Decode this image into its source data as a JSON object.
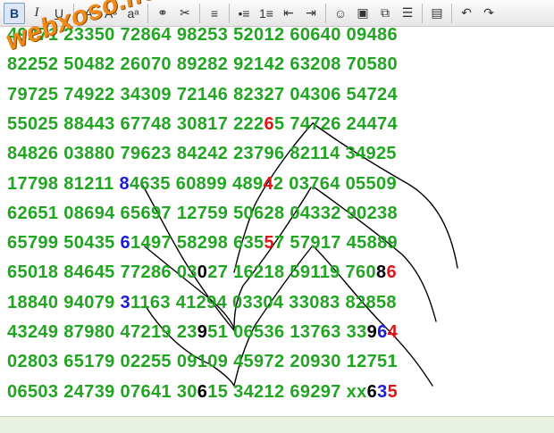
{
  "toolbar": {
    "buttons": [
      {
        "icon": "bold-icon",
        "glyph": "B"
      },
      {
        "icon": "italic-icon",
        "glyph": "I"
      },
      {
        "icon": "underline-icon",
        "glyph": "U"
      },
      {
        "icon": "font-color-icon",
        "glyph": "A"
      },
      {
        "icon": "font-size-icon",
        "glyph": "Aˢ"
      },
      {
        "icon": "superscript-icon",
        "glyph": "aᵃ"
      },
      {
        "icon": "link-icon",
        "glyph": "⚭"
      },
      {
        "icon": "unlink-icon",
        "glyph": "✂"
      },
      {
        "icon": "align-left-icon",
        "glyph": "≡"
      },
      {
        "icon": "bullet-list-icon",
        "glyph": "•≡"
      },
      {
        "icon": "numbered-list-icon",
        "glyph": "1≡"
      },
      {
        "icon": "outdent-icon",
        "glyph": "⇤"
      },
      {
        "icon": "indent-icon",
        "glyph": "⇥"
      },
      {
        "icon": "emoticon-icon",
        "glyph": "☺"
      },
      {
        "icon": "image-icon",
        "glyph": "▣"
      },
      {
        "icon": "paste-icon",
        "glyph": "⧉"
      },
      {
        "icon": "insert-table-icon",
        "glyph": "☰"
      },
      {
        "icon": "save-icon",
        "glyph": "▤"
      },
      {
        "icon": "undo-icon",
        "glyph": "↶"
      },
      {
        "icon": "redo-icon",
        "glyph": "↷"
      }
    ]
  },
  "watermark": "webxoso.net",
  "lines": [
    [
      {
        "t": "49271 23350 72864 98253 52012 60640 09486"
      }
    ],
    [
      {
        "t": "82252 50482 26070 89282 92142 63208 70580"
      }
    ],
    [
      {
        "t": "79725 74922 34309 72146 82327 04306 54724"
      }
    ],
    [
      {
        "t": "55025 88443 67748 30817 222"
      },
      {
        "t": "6",
        "c": "red"
      },
      {
        "t": "5 74726 24474"
      }
    ],
    [
      {
        "t": "84826 03880 79623 84242 23796 82114 34925"
      }
    ],
    [
      {
        "t": "17798 81211 "
      },
      {
        "t": "8",
        "c": "blue"
      },
      {
        "t": "4635 60899 489"
      },
      {
        "t": "4",
        "c": "red"
      },
      {
        "t": "2 03764 05509"
      }
    ],
    [
      {
        "t": "62651 08694 65697 12759 50628 04332 90238"
      }
    ],
    [
      {
        "t": "65799 50435 "
      },
      {
        "t": "6",
        "c": "blue"
      },
      {
        "t": "1497 58298 635"
      },
      {
        "t": "5",
        "c": "red"
      },
      {
        "t": "7 57917 45889"
      }
    ],
    [
      {
        "t": "65018 84645 77286 03"
      },
      {
        "t": "0",
        "c": "black"
      },
      {
        "t": "27 16218 59119 760"
      },
      {
        "t": "8",
        "c": "black"
      },
      {
        "t": "6",
        "c": "red"
      }
    ],
    [
      {
        "t": "18840 94079 "
      },
      {
        "t": "3",
        "c": "blue"
      },
      {
        "t": "1163 41294 03304 33083 82858"
      }
    ],
    [
      {
        "t": "43249 87980 47219 23"
      },
      {
        "t": "9",
        "c": "black"
      },
      {
        "t": "51 06536 13763 33"
      },
      {
        "t": "9",
        "c": "black"
      },
      {
        "t": "6",
        "c": "blue"
      },
      {
        "t": "4",
        "c": "red"
      }
    ],
    [
      {
        "t": "02803 65179 02255 09109 45972 20930 12751"
      }
    ],
    [
      {
        "t": "06503 24739 07641 30"
      },
      {
        "t": "6",
        "c": "black"
      },
      {
        "t": "15 34212 69297 xx"
      },
      {
        "t": "6",
        "c": "black"
      },
      {
        "t": "3",
        "c": "blue"
      },
      {
        "t": "5",
        "c": "red"
      }
    ]
  ]
}
